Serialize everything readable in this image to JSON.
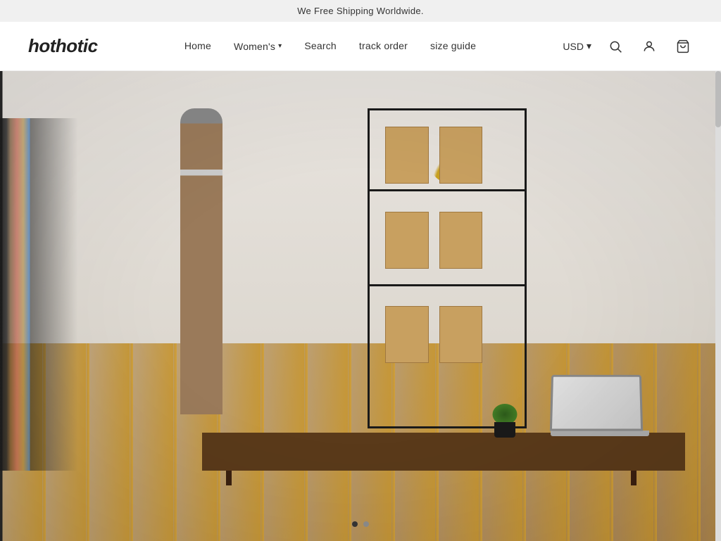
{
  "announcement": {
    "text": "We Free Shipping Worldwide."
  },
  "header": {
    "logo": "hothotic",
    "nav": [
      {
        "label": "Home",
        "id": "home"
      },
      {
        "label": "Women's",
        "id": "womens",
        "has_dropdown": true
      },
      {
        "label": "Search",
        "id": "search-link"
      },
      {
        "label": "track order",
        "id": "track-order"
      },
      {
        "label": "size guide",
        "id": "size-guide"
      }
    ],
    "currency": {
      "value": "USD",
      "dropdown_indicator": "▾"
    },
    "icons": {
      "search": "search-icon",
      "account": "account-icon",
      "cart": "cart-icon"
    }
  },
  "hero": {
    "carousel": {
      "dots": [
        {
          "active": true,
          "index": 1
        },
        {
          "active": false,
          "index": 2
        }
      ]
    }
  }
}
